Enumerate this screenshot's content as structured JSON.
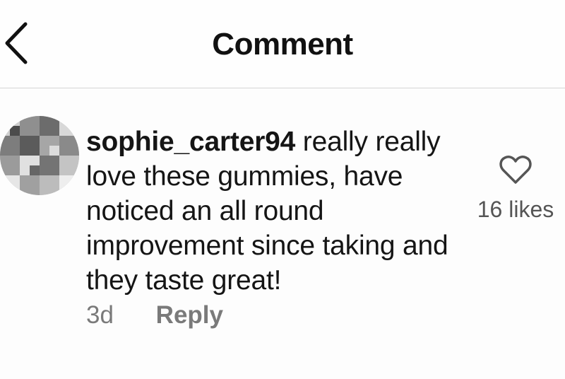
{
  "header": {
    "title": "Comment",
    "back_icon": "chevron-left-icon"
  },
  "comment": {
    "username": "sophie_carter94",
    "text": " really really love these gummies, have noticed an all round improvement since taking and they taste great!",
    "time": "3d",
    "reply_label": "Reply",
    "like_icon": "heart-outline-icon",
    "likes_label": "16 likes"
  },
  "colors": {
    "text": "#151515",
    "muted": "#7a7a7a",
    "divider": "#d6d6d6"
  }
}
